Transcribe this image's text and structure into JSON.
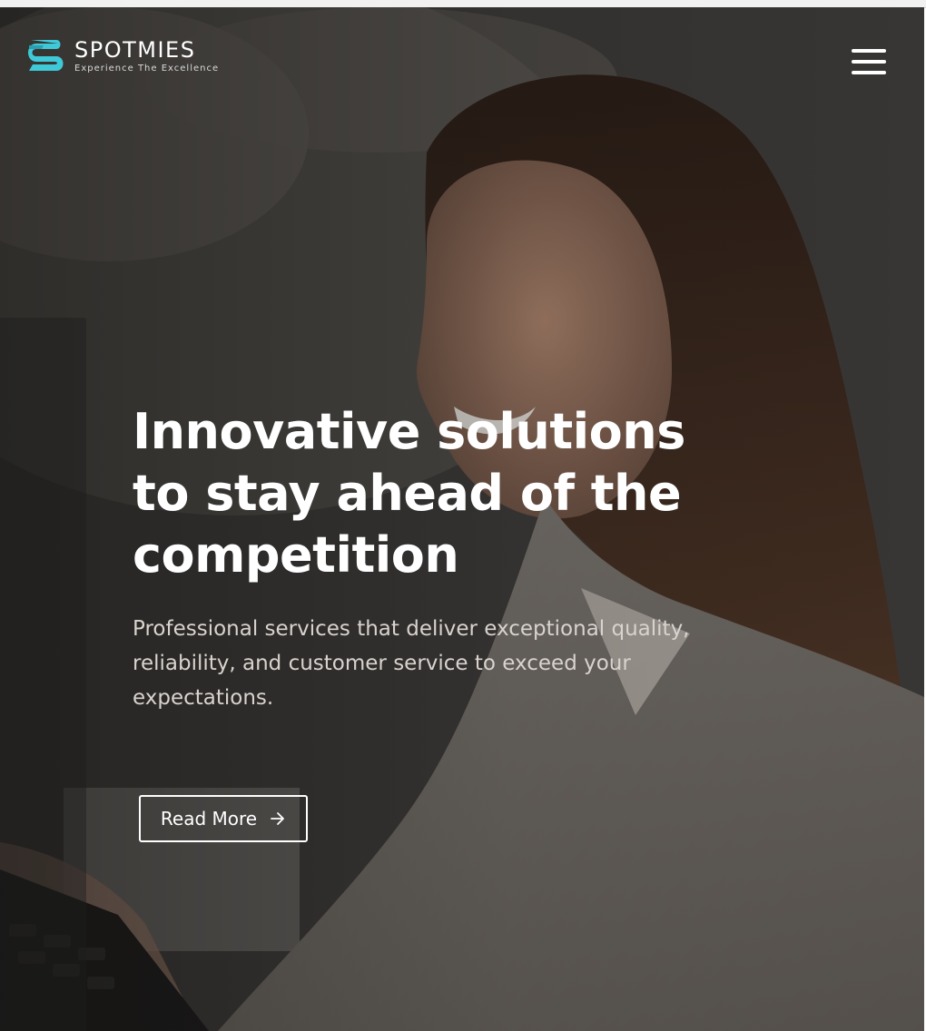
{
  "header": {
    "brand_name": "SPOTMIES",
    "brand_tagline": "Experience The Excellence",
    "menu_icon": "hamburger-menu-icon"
  },
  "hero": {
    "title": "Innovative solutions to stay ahead of the competition",
    "subtitle": "Professional services that deliver exceptional quality, reliability, and customer service to exceed your expectations.",
    "cta_label": "Read More",
    "cta_icon": "arrow-right-icon"
  },
  "colors": {
    "brand_accent": "#3fc9d8",
    "text_primary": "#ffffff",
    "text_secondary": "#d8d3ce"
  }
}
